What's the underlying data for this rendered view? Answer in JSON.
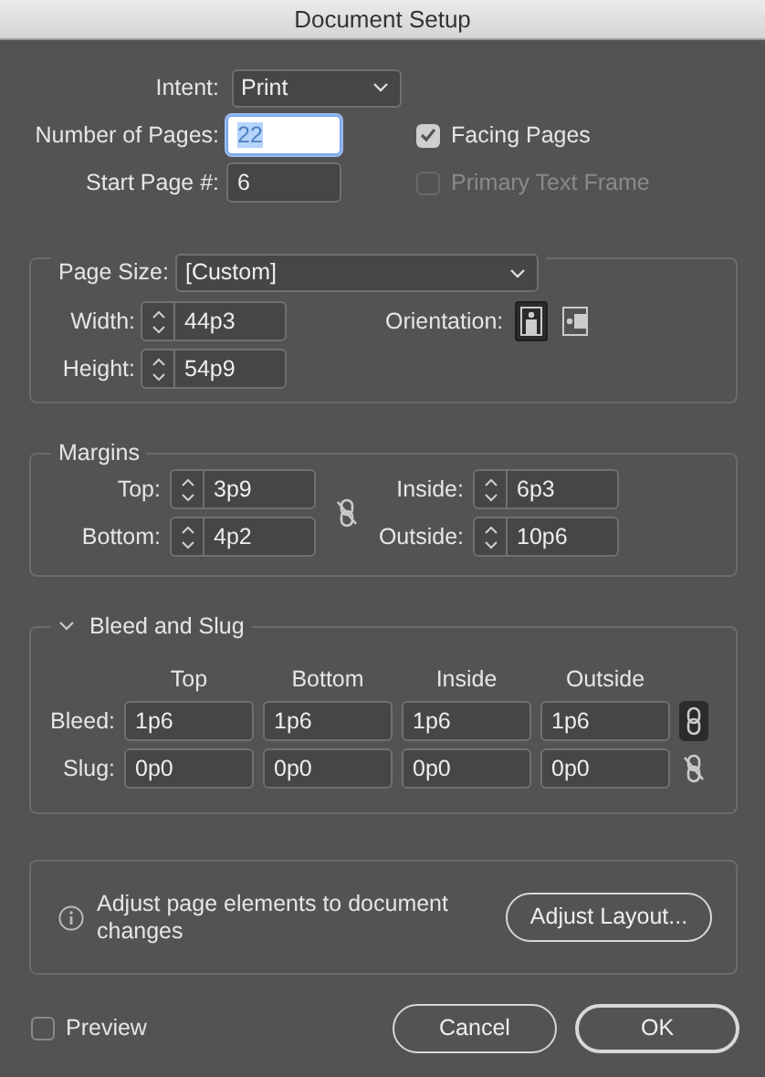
{
  "window": {
    "title": "Document Setup"
  },
  "general": {
    "intent": {
      "label": "Intent:",
      "value": "Print"
    },
    "number_of_pages": {
      "label": "Number of Pages:",
      "value": "22",
      "focused": true
    },
    "start_page": {
      "label": "Start Page #:",
      "value": "6"
    },
    "options": [
      {
        "label": "Facing Pages",
        "checked": true,
        "disabled": false
      },
      {
        "label": "Primary Text Frame",
        "checked": false,
        "disabled": true
      }
    ]
  },
  "page_size": {
    "label": "Page Size:",
    "value": "[Custom]",
    "fields": [
      {
        "label": "Width:",
        "value": "44p3"
      },
      {
        "label": "Height:",
        "value": "54p9"
      }
    ],
    "orientation": {
      "label": "Orientation:",
      "options": [
        {
          "kind": "portrait",
          "selected": true
        },
        {
          "kind": "landscape",
          "selected": false
        }
      ]
    }
  },
  "margins": {
    "title": "Margins",
    "linked": false,
    "fields": [
      {
        "label": "Top:",
        "value": "3p9"
      },
      {
        "label": "Inside:",
        "value": "6p3"
      },
      {
        "label": "Bottom:",
        "value": "4p2"
      },
      {
        "label": "Outside:",
        "value": "10p6"
      }
    ]
  },
  "bleed_and_slug": {
    "title": "Bleed and Slug",
    "expanded": true,
    "columns": [
      "Top",
      "Bottom",
      "Inside",
      "Outside"
    ],
    "rows": [
      {
        "label": "Bleed:",
        "values": [
          "1p6",
          "1p6",
          "1p6",
          "1p6"
        ],
        "linked": true
      },
      {
        "label": "Slug:",
        "values": [
          "0p0",
          "0p0",
          "0p0",
          "0p0"
        ],
        "linked": false
      }
    ]
  },
  "adjust": {
    "message": "Adjust page elements to document changes",
    "button": "Adjust Layout..."
  },
  "preview": {
    "label": "Preview",
    "checked": false
  },
  "buttons": [
    {
      "label": "Cancel",
      "default": false
    },
    {
      "label": "OK",
      "default": true
    }
  ]
}
